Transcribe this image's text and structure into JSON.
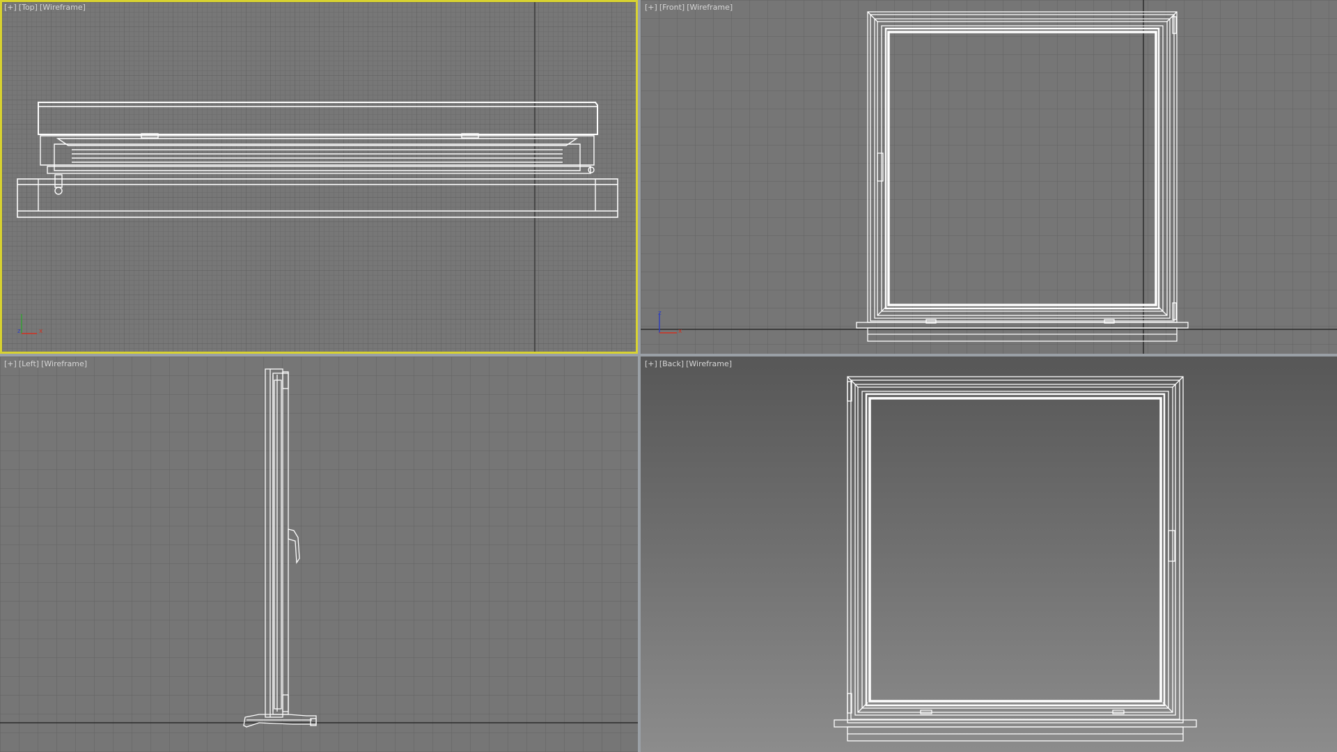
{
  "viewports": {
    "top": {
      "plus": "[+]",
      "view": "[Top]",
      "mode": "[Wireframe]",
      "active": true
    },
    "front": {
      "plus": "[+]",
      "view": "[Front]",
      "mode": "[Wireframe]"
    },
    "left": {
      "plus": "[+]",
      "view": "[Left]",
      "mode": "[Wireframe]"
    },
    "back": {
      "plus": "[+]",
      "view": "[Back]",
      "mode": "[Wireframe]"
    }
  },
  "axes": {
    "z": "z",
    "x": "x"
  },
  "colors": {
    "active_border": "#d8d230",
    "wire": "#ffffff",
    "grid_minor": "#6c6c6c",
    "grid_major": "#5f5f5f",
    "axis_x": "#d03020",
    "axis_z": "#3040c0",
    "axis_y": "#30a030"
  }
}
